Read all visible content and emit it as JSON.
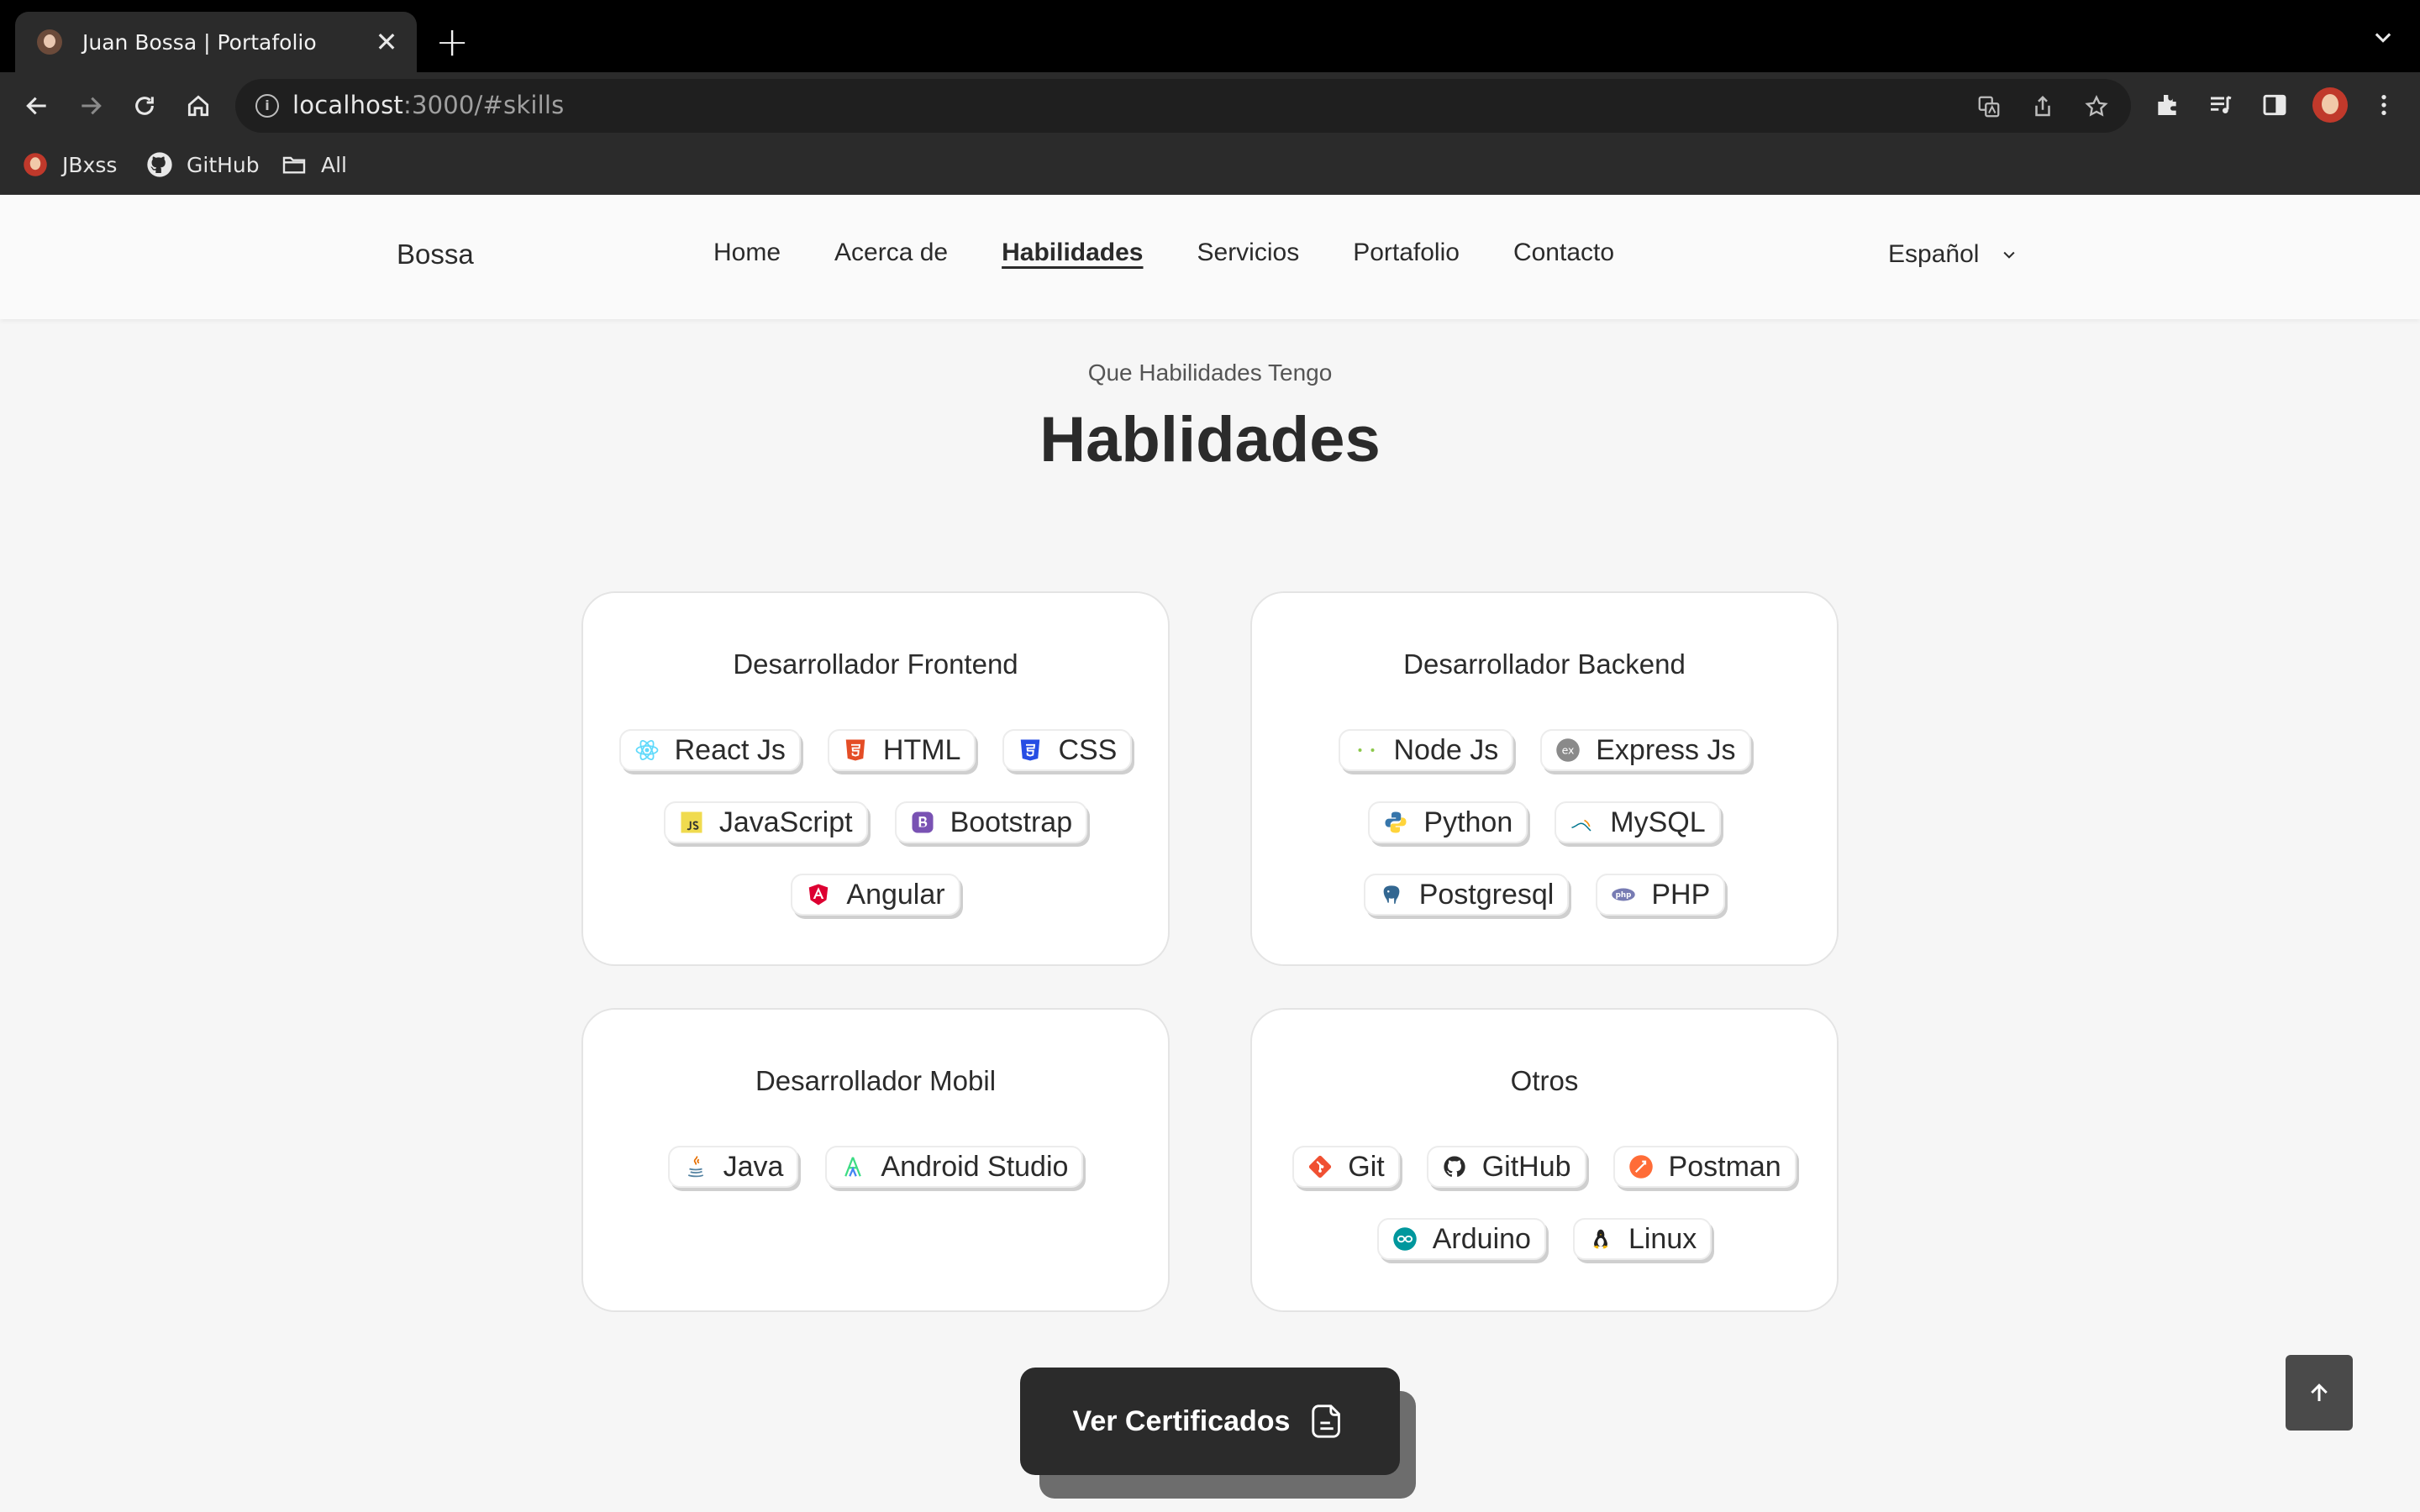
{
  "browser": {
    "tab_title": "Juan Bossa | Portafolio",
    "tab_close": "✕",
    "new_tab": "+",
    "url_host": "localhost",
    "url_rest": ":3000/#skills",
    "bookmarks": [
      {
        "label": "JBxss",
        "icon": "avatar-icon"
      },
      {
        "label": "GitHub",
        "icon": "github-icon"
      },
      {
        "label": "All",
        "icon": "folder-icon"
      }
    ]
  },
  "header": {
    "brand": "Bossa",
    "nav": [
      "Home",
      "Acerca de",
      "Habilidades",
      "Servicios",
      "Portafolio",
      "Contacto"
    ],
    "active_nav": "Habilidades",
    "language": "Español"
  },
  "section": {
    "subtitle": "Que Habilidades Tengo",
    "title": "Hablidades"
  },
  "cards": [
    {
      "title": "Desarrollador Frontend",
      "skills": [
        "React Js",
        "HTML",
        "CSS",
        "JavaScript",
        "Bootstrap",
        "Angular"
      ]
    },
    {
      "title": "Desarrollador Backend",
      "skills": [
        "Node Js",
        "Express Js",
        "Python",
        "MySQL",
        "Postgresql",
        "PHP"
      ]
    },
    {
      "title": "Desarrollador Mobil",
      "skills": [
        "Java",
        "Android Studio"
      ]
    },
    {
      "title": "Otros",
      "skills": [
        "Git",
        "GitHub",
        "Postman",
        "Arduino",
        "Linux"
      ]
    }
  ],
  "cta": {
    "label": "Ver Certificados"
  },
  "colors": {
    "accent_dark": "#2b2b2b",
    "background": "#f6f6f6"
  }
}
